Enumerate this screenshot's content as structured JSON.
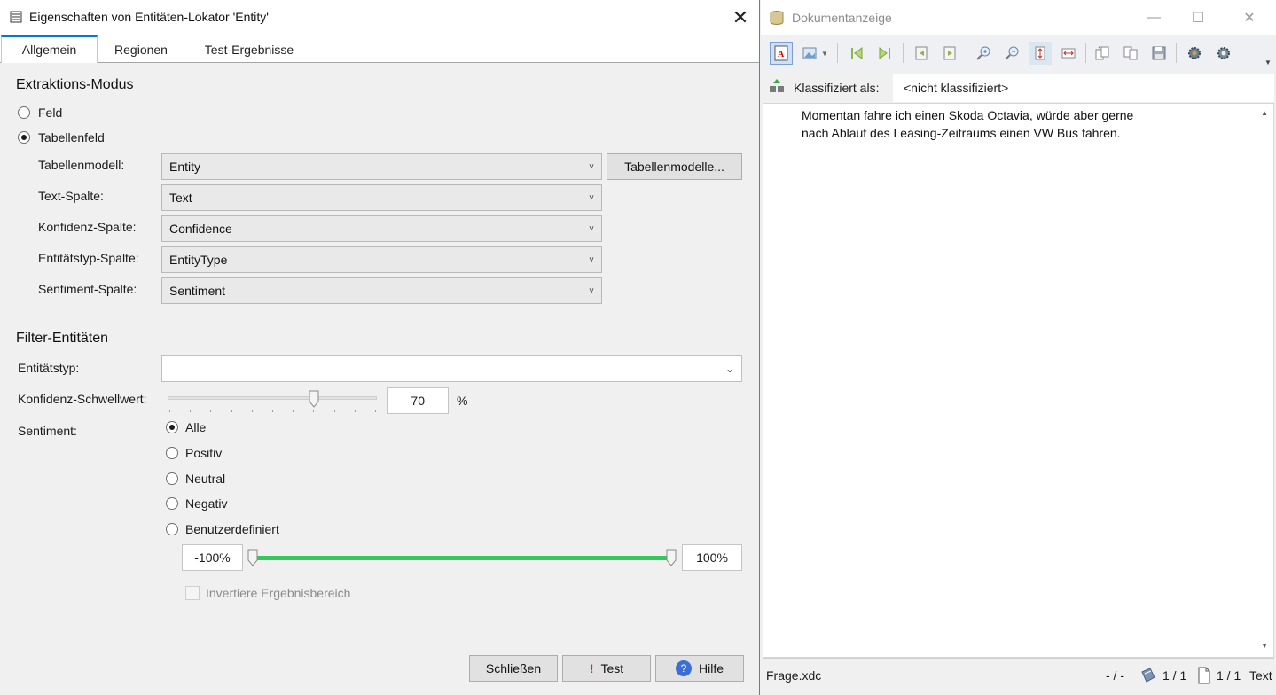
{
  "dialog": {
    "title": "Eigenschaften von Entitäten-Lokator 'Entity'",
    "tabs": [
      {
        "label": "Allgemein",
        "active": true
      },
      {
        "label": "Regionen",
        "active": false
      },
      {
        "label": "Test-Ergebnisse",
        "active": false
      }
    ],
    "extraction": {
      "heading": "Extraktions-Modus",
      "mode_field": "Feld",
      "mode_table": "Tabellenfeld",
      "selected_mode": "Tabellenfeld",
      "table_model_label": "Tabellenmodell:",
      "table_model_value": "Entity",
      "table_models_button": "Tabellenmodelle...",
      "text_col_label": "Text-Spalte:",
      "text_col_value": "Text",
      "conf_col_label": "Konfidenz-Spalte:",
      "conf_col_value": "Confidence",
      "type_col_label": "Entitätstyp-Spalte:",
      "type_col_value": "EntityType",
      "sent_col_label": "Sentiment-Spalte:",
      "sent_col_value": "Sentiment"
    },
    "filter": {
      "heading": "Filter-Entitäten",
      "entity_type_label": "Entitätstyp:",
      "entity_type_value": "",
      "threshold_label": "Konfidenz-Schwellwert:",
      "threshold_value": "70",
      "threshold_unit": "%",
      "threshold_fraction": 0.7,
      "sentiment_label": "Sentiment:",
      "sentiment_options": [
        "Alle",
        "Positiv",
        "Neutral",
        "Negativ",
        "Benutzerdefiniert"
      ],
      "sentiment_selected": "Alle",
      "range_min": "-100%",
      "range_max": "100%",
      "range_low_fraction": 0.0,
      "range_high_fraction": 1.0,
      "invert_label": "Invertiere Ergebnisbereich",
      "invert_checked": false
    },
    "buttons": {
      "close": "Schließen",
      "test": "Test",
      "help": "Hilfe"
    }
  },
  "viewer": {
    "title": "Dokumentanzeige",
    "classified_label": "Klassifiziert als:",
    "classified_value": "<nicht klassifiziert>",
    "document_lines": [
      "Momentan fahre ich einen Skoda Octavia, würde aber gerne",
      "nach Ablauf des Leasing-Zeitraums einen VW Bus fahren."
    ],
    "status": {
      "filename": "Frage.xdc",
      "page_nav": "- / -",
      "doc_count": "1 / 1",
      "page_count": "1 / 1",
      "view_mode": "Text"
    }
  },
  "colors": {
    "accent": "#0078d7",
    "range_fill": "#34c759"
  }
}
